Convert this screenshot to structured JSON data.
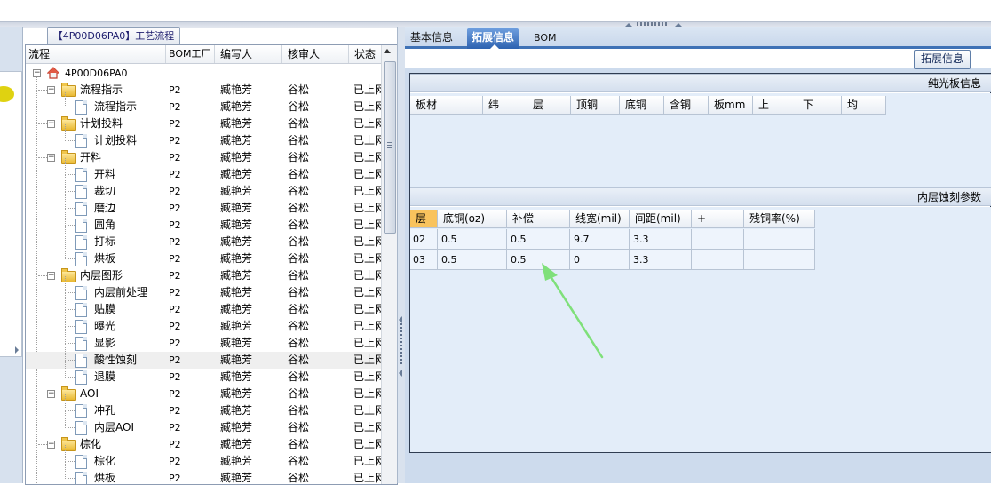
{
  "flow_panel": {
    "title_button": "【4P00D06PA0】工艺流程",
    "columns": [
      "流程",
      "BOM工厂",
      "编写人",
      "核审人",
      "状态"
    ],
    "rows": [
      {
        "name": "4P00D06PA0",
        "level": 0,
        "kind": "root",
        "factory": "",
        "author": "",
        "reviewer": "",
        "status": ""
      },
      {
        "name": "流程指示",
        "level": 1,
        "kind": "folder",
        "factory": "P2",
        "author": "臧艳芳",
        "reviewer": "谷松",
        "status": "已上网"
      },
      {
        "name": "流程指示",
        "level": 2,
        "kind": "doc",
        "factory": "P2",
        "author": "臧艳芳",
        "reviewer": "谷松",
        "status": "已上网"
      },
      {
        "name": "计划投料",
        "level": 1,
        "kind": "folder",
        "factory": "P2",
        "author": "臧艳芳",
        "reviewer": "谷松",
        "status": "已上网"
      },
      {
        "name": "计划投料",
        "level": 2,
        "kind": "doc",
        "factory": "P2",
        "author": "臧艳芳",
        "reviewer": "谷松",
        "status": "已上网"
      },
      {
        "name": "开料",
        "level": 1,
        "kind": "folder",
        "factory": "P2",
        "author": "臧艳芳",
        "reviewer": "谷松",
        "status": "已上网"
      },
      {
        "name": "开料",
        "level": 2,
        "kind": "doc",
        "factory": "P2",
        "author": "臧艳芳",
        "reviewer": "谷松",
        "status": "已上网"
      },
      {
        "name": "裁切",
        "level": 2,
        "kind": "doc",
        "factory": "P2",
        "author": "臧艳芳",
        "reviewer": "谷松",
        "status": "已上网"
      },
      {
        "name": "磨边",
        "level": 2,
        "kind": "doc",
        "factory": "P2",
        "author": "臧艳芳",
        "reviewer": "谷松",
        "status": "已上网"
      },
      {
        "name": "圆角",
        "level": 2,
        "kind": "doc",
        "factory": "P2",
        "author": "臧艳芳",
        "reviewer": "谷松",
        "status": "已上网"
      },
      {
        "name": "打标",
        "level": 2,
        "kind": "doc",
        "factory": "P2",
        "author": "臧艳芳",
        "reviewer": "谷松",
        "status": "已上网"
      },
      {
        "name": "烘板",
        "level": 2,
        "kind": "doc",
        "factory": "P2",
        "author": "臧艳芳",
        "reviewer": "谷松",
        "status": "已上网"
      },
      {
        "name": "内层图形",
        "level": 1,
        "kind": "folder",
        "factory": "P2",
        "author": "臧艳芳",
        "reviewer": "谷松",
        "status": "已上网"
      },
      {
        "name": "内层前处理",
        "level": 2,
        "kind": "doc",
        "factory": "P2",
        "author": "臧艳芳",
        "reviewer": "谷松",
        "status": "已上网"
      },
      {
        "name": "贴膜",
        "level": 2,
        "kind": "doc",
        "factory": "P2",
        "author": "臧艳芳",
        "reviewer": "谷松",
        "status": "已上网"
      },
      {
        "name": "曝光",
        "level": 2,
        "kind": "doc",
        "factory": "P2",
        "author": "臧艳芳",
        "reviewer": "谷松",
        "status": "已上网"
      },
      {
        "name": "显影",
        "level": 2,
        "kind": "doc",
        "factory": "P2",
        "author": "臧艳芳",
        "reviewer": "谷松",
        "status": "已上网"
      },
      {
        "name": "酸性蚀刻",
        "level": 2,
        "kind": "doc",
        "factory": "P2",
        "author": "臧艳芳",
        "reviewer": "谷松",
        "status": "已上网",
        "selected": true
      },
      {
        "name": "退膜",
        "level": 2,
        "kind": "doc",
        "factory": "P2",
        "author": "臧艳芳",
        "reviewer": "谷松",
        "status": "已上网"
      },
      {
        "name": "AOI",
        "level": 1,
        "kind": "folder",
        "factory": "P2",
        "author": "臧艳芳",
        "reviewer": "谷松",
        "status": "已上网"
      },
      {
        "name": "冲孔",
        "level": 2,
        "kind": "doc",
        "factory": "P2",
        "author": "臧艳芳",
        "reviewer": "谷松",
        "status": "已上网"
      },
      {
        "name": "内层AOI",
        "level": 2,
        "kind": "doc",
        "factory": "P2",
        "author": "臧艳芳",
        "reviewer": "谷松",
        "status": "已上网"
      },
      {
        "name": "棕化",
        "level": 1,
        "kind": "folder",
        "factory": "P2",
        "author": "臧艳芳",
        "reviewer": "谷松",
        "status": "已上网"
      },
      {
        "name": "棕化",
        "level": 2,
        "kind": "doc",
        "factory": "P2",
        "author": "臧艳芳",
        "reviewer": "谷松",
        "status": "已上网"
      },
      {
        "name": "烘板",
        "level": 2,
        "kind": "doc",
        "factory": "P2",
        "author": "臧艳芳",
        "reviewer": "谷松",
        "status": "已上网"
      }
    ]
  },
  "tabs": [
    {
      "label": "基本信息",
      "active": false
    },
    {
      "label": "拓展信息",
      "active": true
    },
    {
      "label": "BOM",
      "active": false
    }
  ],
  "ext_button_label": "拓展信息",
  "board_section": {
    "title": "纯光板信息",
    "columns": [
      "板材",
      "纬",
      "层",
      "顶铜",
      "底铜",
      "含铜",
      "板mm",
      "上",
      "下",
      "均"
    ]
  },
  "etch_section": {
    "title": "内层蚀刻参数",
    "columns": [
      "层",
      "底铜(oz)",
      "补偿",
      "线宽(mil)",
      "间距(mil)",
      "+",
      "-",
      "残铜率(%)"
    ],
    "rows": [
      [
        "02",
        "0.5",
        "0.5",
        "9.7",
        "3.3",
        "",
        "",
        ""
      ],
      [
        "03",
        "0.5",
        "0.5",
        "0",
        "3.3",
        "",
        "",
        ""
      ]
    ]
  },
  "colors": {
    "active_tab": "#3f72b6",
    "annotation_arrow": "#7fe07a",
    "header_highlight": "#f9c35d"
  }
}
